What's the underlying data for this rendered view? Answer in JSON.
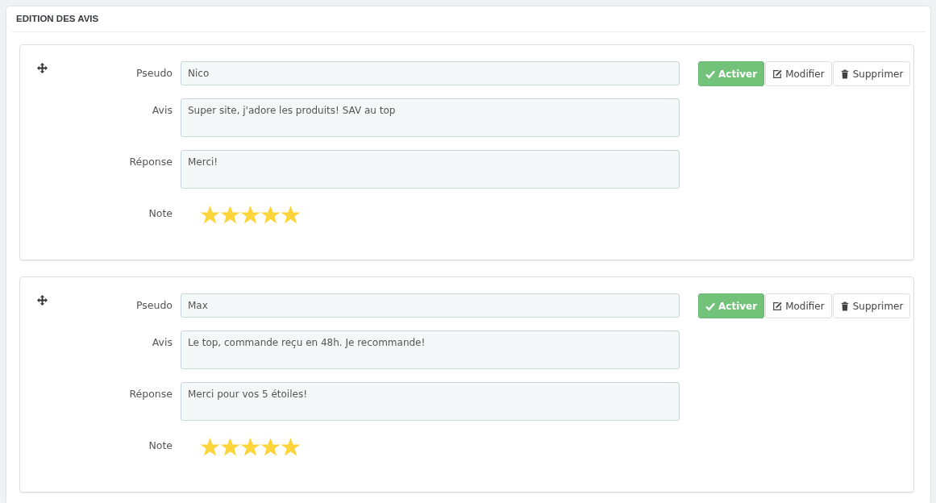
{
  "panel": {
    "title": "EDITION DES AVIS"
  },
  "reviews": [
    {
      "fields": [
        {
          "label": "Pseudo",
          "kind": "input",
          "value": "Nico"
        },
        {
          "label": "Avis",
          "kind": "textarea",
          "value": "Super site, j'adore les produits! SAV au top"
        },
        {
          "label": "Réponse",
          "kind": "textarea",
          "value": "Merci!"
        }
      ],
      "rating_label": "Note",
      "stars": 5,
      "buttons": [
        {
          "kind": "activate",
          "label": "Activer",
          "active": true
        },
        {
          "kind": "edit",
          "label": "Modifier"
        },
        {
          "kind": "delete",
          "label": "Supprimer"
        }
      ]
    },
    {
      "fields": [
        {
          "label": "Pseudo",
          "kind": "input",
          "value": "Max"
        },
        {
          "label": "Avis",
          "kind": "textarea",
          "value": "Le top, commande reçu en 48h. Je recommande!"
        },
        {
          "label": "Réponse",
          "kind": "textarea",
          "value": "Merci pour vos 5 étoiles!"
        }
      ],
      "rating_label": "Note",
      "stars": 5,
      "buttons": [
        {
          "kind": "activate",
          "label": "Activer",
          "active": true
        },
        {
          "kind": "edit",
          "label": "Modifier"
        },
        {
          "kind": "delete",
          "label": "Supprimer"
        }
      ]
    }
  ]
}
